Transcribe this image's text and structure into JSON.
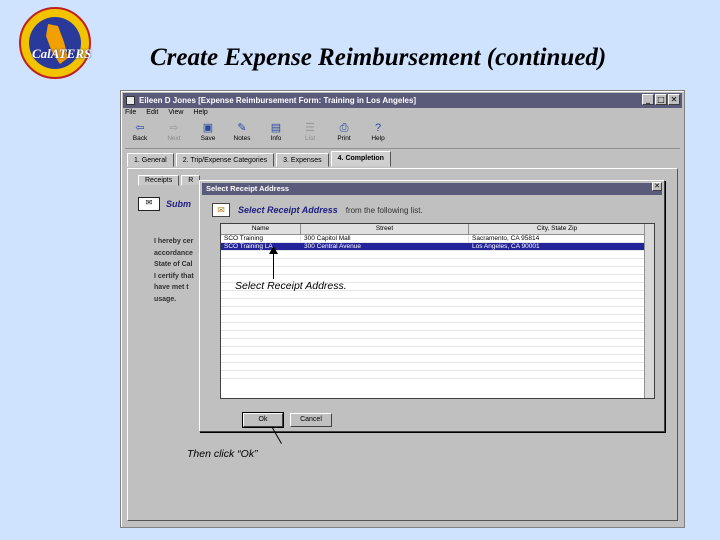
{
  "logo": {
    "text": "CalATERS"
  },
  "slide": {
    "title": "Create Expense Reimbursement (continued)"
  },
  "window": {
    "title": "Eileen D Jones [Expense Reimbursement Form: Training in Los Angeles]",
    "menu": [
      "File",
      "Edit",
      "View",
      "Help"
    ],
    "toolbar": [
      {
        "label": "Back",
        "icon": "back-arrow-icon",
        "disabled": false
      },
      {
        "label": "Next",
        "icon": "next-arrow-icon",
        "disabled": true
      },
      {
        "label": "Save",
        "icon": "save-icon",
        "disabled": false
      },
      {
        "label": "Notes",
        "icon": "notes-icon",
        "disabled": false
      },
      {
        "label": "Info",
        "icon": "info-icon",
        "disabled": false
      },
      {
        "label": "List",
        "icon": "list-icon",
        "disabled": true
      },
      {
        "label": "Print",
        "icon": "print-icon",
        "disabled": false
      },
      {
        "label": "Help",
        "icon": "help-icon",
        "disabled": false
      }
    ],
    "tabs": [
      "1. General",
      "2. Trip/Expense Categories",
      "3. Expenses",
      "4. Completion"
    ],
    "subtabs": [
      "Receipts",
      "R"
    ],
    "underlying_heading": "Subm",
    "body_lines": [
      "I hereby cer",
      "accordance",
      "State of Cal",
      "I certify that",
      "have met t",
      "usage."
    ]
  },
  "dialog": {
    "title": "Select Receipt Address",
    "heading_strong": "Select Receipt Address",
    "heading_rest": "from the following list.",
    "columns": [
      "Name",
      "Street",
      "City, State Zip"
    ],
    "rows": [
      {
        "name": "SCO Training",
        "street": "300 Capitol Mall",
        "city": "Sacramento, CA 95814",
        "selected": false
      },
      {
        "name": "SCO Training LA",
        "street": "300 Central Avenue",
        "city": "Los Angeles, CA 90001",
        "selected": true
      }
    ],
    "ok_label": "Ok",
    "cancel_label": "Cancel"
  },
  "annotations": {
    "select_address": "Select Receipt Address.",
    "click_ok": "Then click “Ok”"
  }
}
